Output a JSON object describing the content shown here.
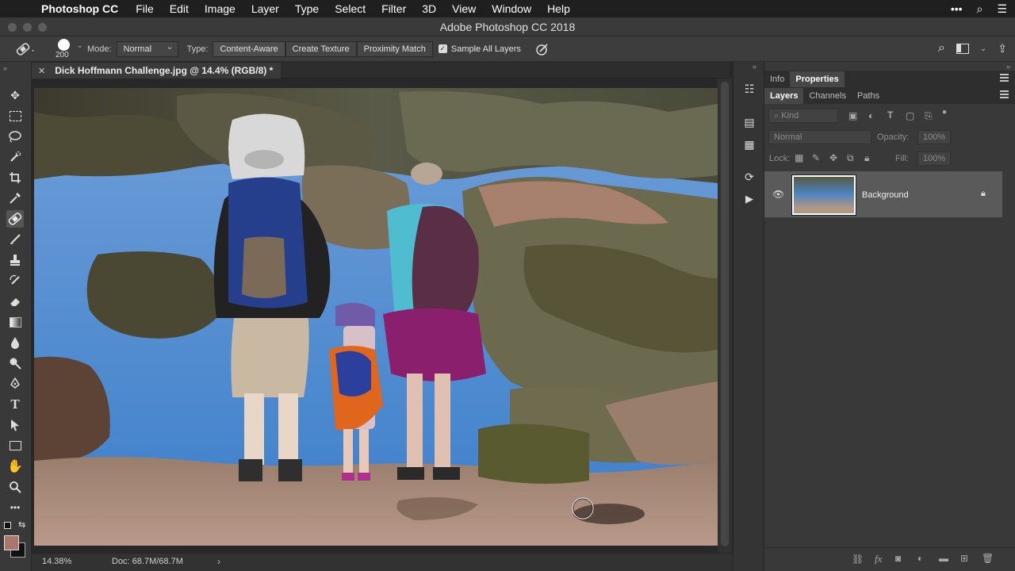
{
  "menubar": {
    "app_name": "Photoshop CC",
    "items": [
      "File",
      "Edit",
      "Image",
      "Layer",
      "Type",
      "Select",
      "Filter",
      "3D",
      "View",
      "Window",
      "Help"
    ]
  },
  "window": {
    "title": "Adobe Photoshop CC 2018"
  },
  "options": {
    "brush_size": "200",
    "mode_label": "Mode:",
    "mode_value": "Normal",
    "type_label": "Type:",
    "type_buttons": [
      "Content-Aware",
      "Create Texture",
      "Proximity Match"
    ],
    "sample_all_layers": "Sample All Layers"
  },
  "document": {
    "tab_title": "Dick Hoffmann Challenge.jpg @ 14.4% (RGB/8) *"
  },
  "status": {
    "zoom": "14.38%",
    "doc_size": "Doc: 68.7M/68.7M"
  },
  "panels": {
    "top_tabs": [
      "Info",
      "Properties"
    ],
    "layer_tabs": [
      "Layers",
      "Channels",
      "Paths"
    ],
    "kind_placeholder": "Kind",
    "blend_mode": "Normal",
    "opacity_label": "Opacity:",
    "opacity_value": "100%",
    "lock_label": "Lock:",
    "fill_label": "Fill:",
    "fill_value": "100%",
    "layers": [
      {
        "name": "Background"
      }
    ]
  },
  "colors": {
    "foreground": "#a8776e",
    "background": "#111111",
    "accent": "#474747"
  }
}
